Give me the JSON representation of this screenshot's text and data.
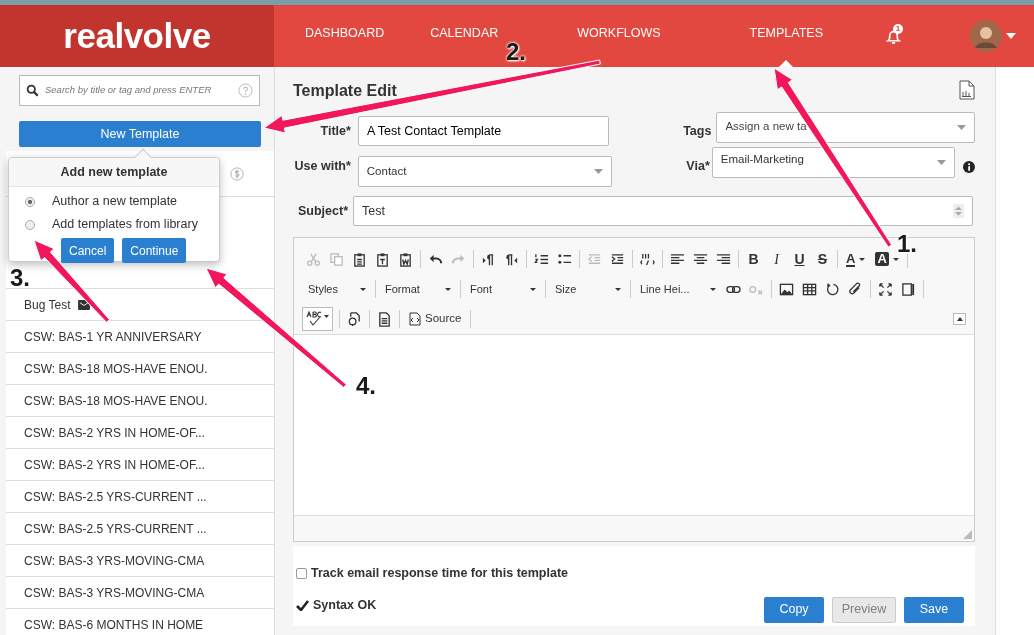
{
  "logo": "realvolve",
  "nav": [
    {
      "label": "DASHBOARD",
      "selected": false
    },
    {
      "label": "CALENDAR",
      "selected": false
    },
    {
      "label": "WORKFLOWS",
      "selected": false
    },
    {
      "label": "TEMPLATES",
      "selected": true
    }
  ],
  "notifications": {
    "count": "1"
  },
  "sidebar": {
    "search": {
      "placeholder": "Search by title or tag and press ENTER"
    },
    "new_button": "New Template",
    "templates": [
      {
        "title": "Bug Test",
        "has_icon": true
      },
      {
        "title": "CSW: BAS-1 YR ANNIVERSARY",
        "has_icon": false
      },
      {
        "title": "CSW: BAS-18 MOS-HAVE ENOU.",
        "has_icon": false
      },
      {
        "title": "CSW: BAS-18 MOS-HAVE ENOU.",
        "has_icon": false
      },
      {
        "title": "CSW: BAS-2 YRS IN HOME-OF...",
        "has_icon": false
      },
      {
        "title": "CSW: BAS-2 YRS IN HOME-OF...",
        "has_icon": false
      },
      {
        "title": "CSW: BAS-2.5 YRS-CURRENT ...",
        "has_icon": false
      },
      {
        "title": "CSW: BAS-2.5 YRS-CURRENT ...",
        "has_icon": false
      },
      {
        "title": "CSW: BAS-3 YRS-MOVING-CMA",
        "has_icon": false
      },
      {
        "title": "CSW: BAS-3 YRS-MOVING-CMA",
        "has_icon": false
      },
      {
        "title": "CSW: BAS-6 MONTHS IN HOME",
        "has_icon": false
      }
    ]
  },
  "popover": {
    "title": "Add new template",
    "options": [
      {
        "label": "Author a new template",
        "selected": true
      },
      {
        "label": "Add templates from library",
        "selected": false
      }
    ],
    "buttons": [
      "Cancel",
      "Continue"
    ]
  },
  "editor": {
    "heading": "Template Edit",
    "fields": {
      "title": {
        "label": "Title*",
        "value": "A Test Contact Template"
      },
      "tags": {
        "label": "Tags",
        "placeholder": "Assign a new ta"
      },
      "use_with": {
        "label": "Use with*",
        "value": "Contact"
      },
      "via": {
        "label": "Via*",
        "value": "Email-Marketing"
      },
      "subject": {
        "label": "Subject*",
        "value": "Test"
      }
    },
    "toolbar": [
      [
        {
          "kind": "icon",
          "disabled": true
        },
        {
          "kind": "icon",
          "disabled": true
        },
        {
          "kind": "icon",
          "disabled": false
        },
        {
          "kind": "icon",
          "disabled": false
        },
        {
          "kind": "icon",
          "disabled": false
        },
        {
          "kind": "separator"
        },
        {
          "kind": "icon",
          "disabled": false
        },
        {
          "kind": "icon",
          "disabled": true
        },
        {
          "kind": "separator"
        },
        {
          "kind": "icon",
          "disabled": false
        },
        {
          "kind": "icon",
          "disabled": false
        },
        {
          "kind": "separator"
        },
        {
          "kind": "icon",
          "disabled": false
        },
        {
          "kind": "icon",
          "disabled": false
        },
        {
          "kind": "separator"
        },
        {
          "kind": "icon",
          "disabled": true
        },
        {
          "kind": "icon",
          "disabled": false
        },
        {
          "kind": "separator"
        },
        {
          "kind": "icon",
          "disabled": false
        },
        {
          "kind": "separator"
        },
        {
          "kind": "icon",
          "disabled": false
        },
        {
          "kind": "icon",
          "disabled": false
        },
        {
          "kind": "icon",
          "disabled": false
        },
        {
          "kind": "separator"
        },
        {
          "kind": "glyph",
          "label": "B"
        },
        {
          "kind": "glyph",
          "label": "I"
        },
        {
          "kind": "glyph",
          "label": "U"
        },
        {
          "kind": "glyph",
          "label": "S"
        },
        {
          "kind": "separator"
        },
        {
          "kind": "color",
          "label": "A"
        },
        {
          "kind": "color",
          "label": "A"
        },
        {
          "kind": "separator"
        }
      ],
      [
        {
          "kind": "dropdown",
          "label": "Styles"
        },
        {
          "kind": "separator"
        },
        {
          "kind": "dropdown",
          "label": "Format"
        },
        {
          "kind": "separator"
        },
        {
          "kind": "dropdown",
          "label": "Font"
        },
        {
          "kind": "separator"
        },
        {
          "kind": "dropdown",
          "label": "Size"
        },
        {
          "kind": "separator"
        },
        {
          "kind": "dropdown",
          "label": "Line Hei..."
        },
        {
          "kind": "icon",
          "disabled": false
        },
        {
          "kind": "icon",
          "disabled": true
        },
        {
          "kind": "separator"
        },
        {
          "kind": "icon",
          "disabled": false
        },
        {
          "kind": "icon",
          "disabled": false
        },
        {
          "kind": "icon",
          "disabled": false
        },
        {
          "kind": "icon",
          "disabled": false
        },
        {
          "kind": "separator"
        },
        {
          "kind": "icon",
          "disabled": false
        },
        {
          "kind": "icon",
          "disabled": false
        },
        {
          "kind": "separator"
        }
      ],
      [
        {
          "kind": "spell"
        },
        {
          "kind": "separator"
        },
        {
          "kind": "icon",
          "disabled": false
        },
        {
          "kind": "separator"
        },
        {
          "kind": "icon",
          "disabled": false
        },
        {
          "kind": "separator"
        },
        {
          "kind": "labeled",
          "label": "Source"
        },
        {
          "kind": "separator"
        }
      ]
    ]
  },
  "footer": {
    "track": {
      "label": "Track email response time for this template",
      "checked": false
    },
    "syntax": "Syntax OK",
    "buttons": [
      {
        "label": "Copy",
        "disabled": false
      },
      {
        "label": "Preview",
        "disabled": true
      },
      {
        "label": "Save",
        "disabled": false
      }
    ]
  },
  "annotations": [
    {
      "number": "1."
    },
    {
      "number": "2."
    },
    {
      "number": "3."
    },
    {
      "number": "4."
    }
  ]
}
